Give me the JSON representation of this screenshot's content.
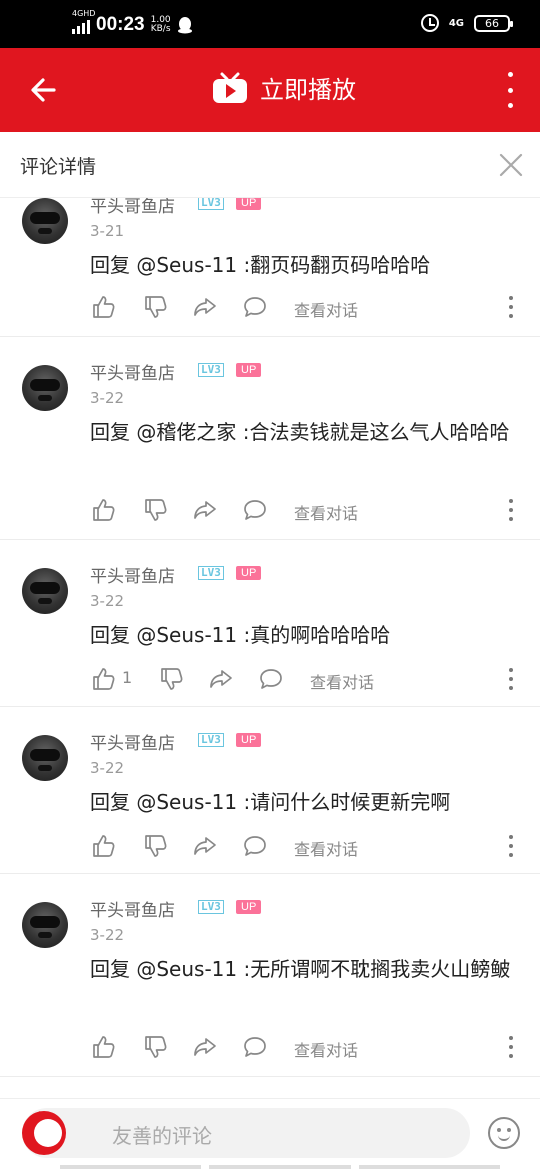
{
  "status_bar": {
    "network": "4GHD",
    "time": "00:23",
    "speed_value": "1.00",
    "speed_unit": "KB/s",
    "net_right": "4G",
    "battery": "66"
  },
  "top_bar": {
    "title": "立即播放",
    "colors": {
      "background": "#e0161f",
      "text": "#ffffff"
    }
  },
  "detail_header": {
    "title": "评论详情"
  },
  "comments": [
    {
      "user": "平头哥鱼店",
      "level": "LV3",
      "up": "UP",
      "date": "3-21",
      "text": "回复 @Seus-11 :翻页码翻页码哈哈哈",
      "likes": "",
      "view_label": "查看对话"
    },
    {
      "user": "平头哥鱼店",
      "level": "LV3",
      "up": "UP",
      "date": "3-22",
      "text": "回复 @稽佬之家 :合法卖钱就是这么气人哈哈哈",
      "likes": "",
      "view_label": "查看对话"
    },
    {
      "user": "平头哥鱼店",
      "level": "LV3",
      "up": "UP",
      "date": "3-22",
      "text": "回复 @Seus-11 :真的啊哈哈哈哈",
      "likes": "1",
      "view_label": "查看对话"
    },
    {
      "user": "平头哥鱼店",
      "level": "LV3",
      "up": "UP",
      "date": "3-22",
      "text": "回复 @Seus-11 :请问什么时候更新完啊",
      "likes": "",
      "view_label": "查看对话"
    },
    {
      "user": "平头哥鱼店",
      "level": "LV3",
      "up": "UP",
      "date": "3-22",
      "text": "回复 @Seus-11 :无所谓啊不耽搁我卖火山鳑鲏",
      "likes": "",
      "view_label": "查看对话"
    }
  ],
  "bottom_bar": {
    "placeholder": "友善的评论"
  }
}
